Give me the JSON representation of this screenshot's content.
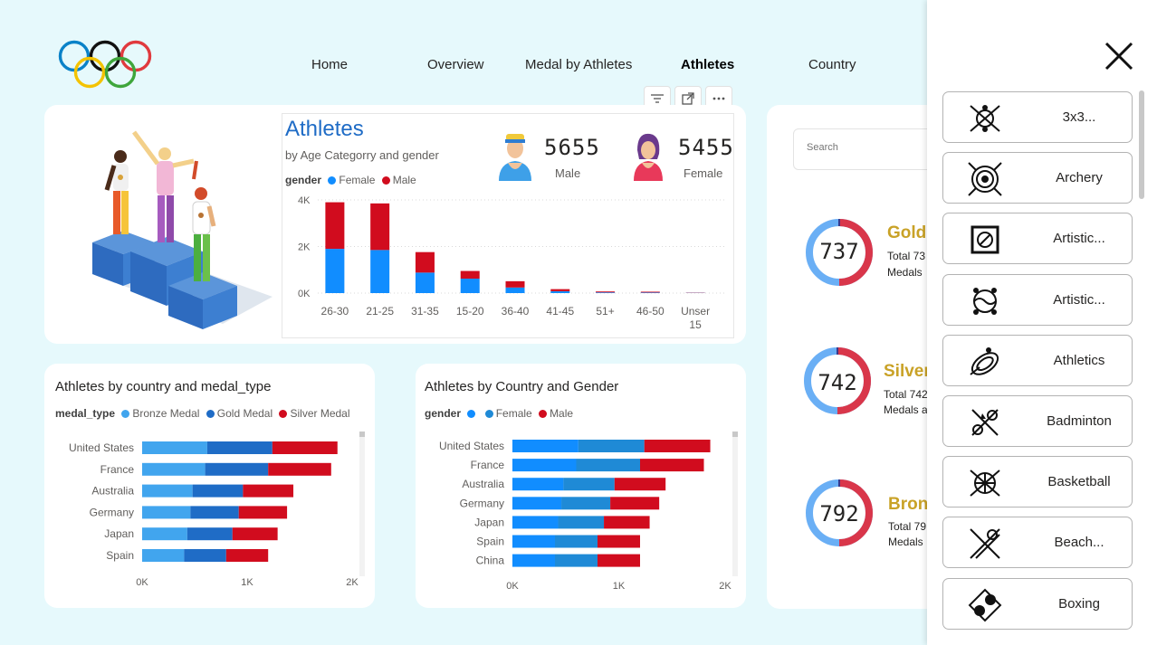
{
  "nav": {
    "items": [
      {
        "label": "Home"
      },
      {
        "label": "Overview"
      },
      {
        "label": "Medal by Athletes"
      },
      {
        "label": "Athletes"
      },
      {
        "label": "Country"
      }
    ]
  },
  "visual_toolbar": {
    "filter_icon": "filter-icon",
    "focus_icon": "focus-mode-icon",
    "more_icon": "more-options-icon"
  },
  "athletes_card": {
    "title": "Athletes",
    "subtitle": "by Age Categorry and gender",
    "legend_title": "gender",
    "legend": [
      {
        "name": "Female",
        "color": "#118dff"
      },
      {
        "name": "Male",
        "color": "#d10c1e"
      }
    ],
    "male": {
      "value": "5655",
      "label": "Male"
    },
    "female": {
      "value": "5455",
      "label": "Female"
    }
  },
  "search": {
    "placeholder": "Search"
  },
  "medals": [
    {
      "value": "737",
      "title": "Gold",
      "line1": "Total 73",
      "line2": "Medals",
      "color": "#c9a227"
    },
    {
      "value": "742",
      "title": "Silver",
      "line1": "Total 742",
      "line2": "Medals a",
      "color": "#c9a227"
    },
    {
      "value": "792",
      "title": "Bron",
      "line1": "Total 79",
      "line2": "Medals",
      "color": "#c9a227"
    }
  ],
  "chart_medal_type": {
    "title": "Athletes by country and medal_type",
    "legend_title": "medal_type",
    "legend": [
      {
        "name": "Bronze Medal",
        "color": "#41a5ee"
      },
      {
        "name": "Gold Medal",
        "color": "#1f6cc6"
      },
      {
        "name": "Silver Medal",
        "color": "#d10c1e"
      }
    ]
  },
  "chart_gender": {
    "title": "Athletes by Country and Gender",
    "legend_title": "gender",
    "legend": [
      {
        "name": "",
        "color": "#118dff"
      },
      {
        "name": "Female",
        "color": "#1f8ad6"
      },
      {
        "name": "Male",
        "color": "#d10c1e"
      }
    ]
  },
  "sports": [
    {
      "label": "3x3...",
      "icon": "basketball-3x3-icon"
    },
    {
      "label": "Archery",
      "icon": "archery-target-icon"
    },
    {
      "label": "Artistic...",
      "icon": "artistic-gymnastics-icon"
    },
    {
      "label": "Artistic...",
      "icon": "artistic-swimming-icon"
    },
    {
      "label": "Athletics",
      "icon": "athletics-track-icon"
    },
    {
      "label": "Badminton",
      "icon": "badminton-icon"
    },
    {
      "label": "Basketball",
      "icon": "basketball-icon"
    },
    {
      "label": "Beach...",
      "icon": "beach-volleyball-icon"
    },
    {
      "label": "Boxing",
      "icon": "boxing-icon"
    }
  ],
  "chart_data": [
    {
      "type": "bar",
      "stacked": true,
      "categories": [
        "26-30",
        "21-25",
        "31-35",
        "15-20",
        "36-40",
        "41-45",
        "51+",
        "46-50",
        "Unser 15"
      ],
      "series": [
        {
          "name": "Female",
          "color": "#118dff",
          "values": [
            1900,
            1850,
            880,
            620,
            240,
            80,
            30,
            25,
            12
          ]
        },
        {
          "name": "Male",
          "color": "#d10c1e",
          "values": [
            2000,
            2000,
            880,
            330,
            270,
            90,
            40,
            35,
            10
          ]
        }
      ],
      "ylim": [
        0,
        4000
      ],
      "yticks": [
        "0K",
        "2K",
        "4K"
      ],
      "grid": true
    },
    {
      "type": "bar",
      "orientation": "horizontal",
      "stacked": true,
      "categories": [
        "United States",
        "France",
        "Australia",
        "Germany",
        "Japan",
        "Spain"
      ],
      "series": [
        {
          "name": "Bronze Medal",
          "color": "#41a5ee",
          "values": [
            620,
            600,
            480,
            460,
            430,
            400
          ]
        },
        {
          "name": "Gold Medal",
          "color": "#1f6cc6",
          "values": [
            620,
            600,
            480,
            460,
            430,
            400
          ]
        },
        {
          "name": "Silver Medal",
          "color": "#d10c1e",
          "values": [
            620,
            600,
            480,
            460,
            430,
            400
          ]
        }
      ],
      "xlim": [
        0,
        2000
      ],
      "xticks": [
        "0K",
        "1K",
        "2K"
      ]
    },
    {
      "type": "bar",
      "orientation": "horizontal",
      "stacked": true,
      "categories": [
        "United States",
        "France",
        "Australia",
        "Germany",
        "Japan",
        "Spain",
        "China"
      ],
      "series": [
        {
          "name": "",
          "color": "#118dff",
          "values": [
            620,
            600,
            480,
            460,
            430,
            400,
            400
          ]
        },
        {
          "name": "Female",
          "color": "#1f8ad6",
          "values": [
            620,
            600,
            480,
            460,
            430,
            400,
            400
          ]
        },
        {
          "name": "Male",
          "color": "#d10c1e",
          "values": [
            620,
            600,
            480,
            460,
            430,
            400,
            400
          ]
        }
      ],
      "xlim": [
        0,
        2000
      ],
      "xticks": [
        "0K",
        "1K",
        "2K"
      ]
    }
  ]
}
